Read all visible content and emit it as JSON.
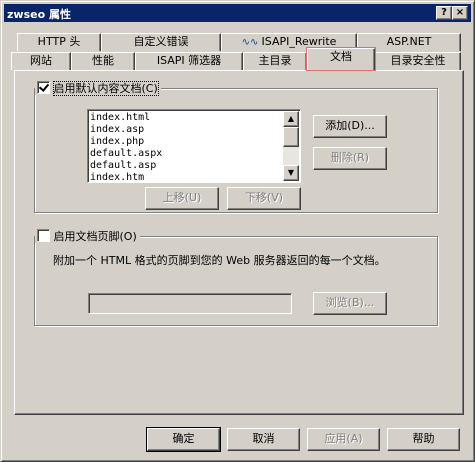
{
  "window": {
    "title": "zwseo 属性",
    "help_button": "?",
    "close_button": "×"
  },
  "tabs_back": [
    "HTTP 头",
    "自定义错误",
    "ISAPI_Rewrite",
    "ASP.NET"
  ],
  "tabs_front": [
    "网站",
    "性能",
    "ISAPI 筛选器",
    "主目录",
    "文档",
    "目录安全性"
  ],
  "isapi_icon": "wave-icon",
  "default_doc": {
    "label": "启用默认内容文档(C)",
    "checked": true,
    "files": [
      "index.html",
      "index.asp",
      "index.php",
      "default.aspx",
      "default.asp",
      "index.htm"
    ],
    "add": "添加(D)...",
    "remove": "删除(R)",
    "move_up": "上移(U)",
    "move_down": "下移(V)"
  },
  "footer": {
    "label": "启用文档页脚(O)",
    "checked": false,
    "description": "附加一个 HTML 格式的页脚到您的 Web 服务器返回的每一个文档。",
    "path_value": "",
    "browse": "浏览(B)..."
  },
  "buttons": {
    "ok": "确定",
    "cancel": "取消",
    "apply": "应用(A)",
    "help": "帮助"
  }
}
